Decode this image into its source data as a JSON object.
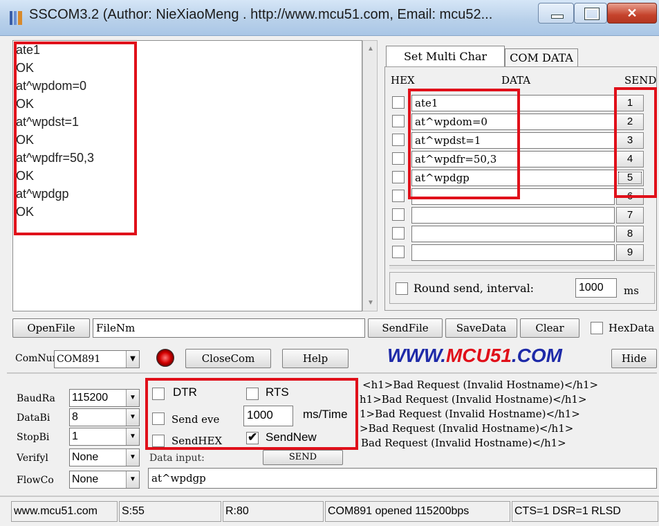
{
  "window": {
    "title": "SSCOM3.2 (Author: NieXiaoMeng . http://www.mcu51.com, Email: mcu52...",
    "controls": {
      "minimize": "minimize-icon",
      "maximize": "maximize-icon",
      "close": "close-icon"
    }
  },
  "receive": {
    "lines": [
      "ate1",
      "OK",
      "at^wpdom=0",
      "OK",
      "at^wpdst=1",
      "OK",
      "at^wpdfr=50,3",
      "OK",
      "at^wpdgp",
      "OK"
    ]
  },
  "tabs": [
    "Set Multi Char",
    "COM DATA"
  ],
  "multi": {
    "headers": {
      "hex": "HEX",
      "data": "DATA",
      "send": "SEND"
    },
    "rows": [
      {
        "data": "ate1",
        "send": "1"
      },
      {
        "data": "at^wpdom=0",
        "send": "2"
      },
      {
        "data": "at^wpdst=1",
        "send": "3"
      },
      {
        "data": "at^wpdfr=50,3",
        "send": "4"
      },
      {
        "data": "at^wpdgp",
        "send": "5"
      },
      {
        "data": "",
        "send": "6"
      },
      {
        "data": "",
        "send": "7"
      },
      {
        "data": "",
        "send": "8"
      },
      {
        "data": "",
        "send": "9"
      }
    ],
    "round_send_label": "Round send, interval:",
    "interval": "1000",
    "unit": "ms"
  },
  "toolbar": {
    "openfile": "OpenFile",
    "filename": "FileNm",
    "sendfile": "SendFile",
    "savedata": "SaveData",
    "clear": "Clear",
    "hexdata": "HexData"
  },
  "com": {
    "comnum_label": "ComNum",
    "comnum_value": "COM891",
    "closecom": "CloseCom",
    "help": "Help",
    "hide": "Hide",
    "website": "WWW.MCU51.COM"
  },
  "settings": {
    "baud_label": "BaudRa",
    "baud": "115200",
    "databits_label": "DataBi",
    "databits": "8",
    "stopbits_label": "StopBi",
    "stopbits": "1",
    "verify_label": "Verifyl",
    "verify": "None",
    "flow_label": "FlowCo",
    "flow": "None"
  },
  "options": {
    "dtr": "DTR",
    "rts": "RTS",
    "send_every": "Send eve",
    "interval": "1000",
    "ms_time": "ms/Time",
    "sendhex": "SendHEX",
    "sendnew": "SendNew",
    "data_input_label": "Data input:",
    "send_button": "SEND",
    "input_value": "at^wpdgp"
  },
  "log": [
    "<h1>Bad Request (Invalid Hostname)</h1>",
    "h1>Bad Request (Invalid Hostname)</h1>",
    "1>Bad Request (Invalid Hostname)</h1>",
    ">Bad Request (Invalid Hostname)</h1>",
    "Bad Request (Invalid Hostname)</h1>"
  ],
  "status": {
    "site": "www.mcu51.com",
    "sent": "S:55",
    "received": "R:80",
    "port": "COM891 opened 115200bps",
    "lines": "CTS=1 DSR=1 RLSD"
  },
  "colors": {
    "highlight": "#e0101a",
    "website": "#1e2aa8",
    "website_accent": "#e0101a"
  }
}
